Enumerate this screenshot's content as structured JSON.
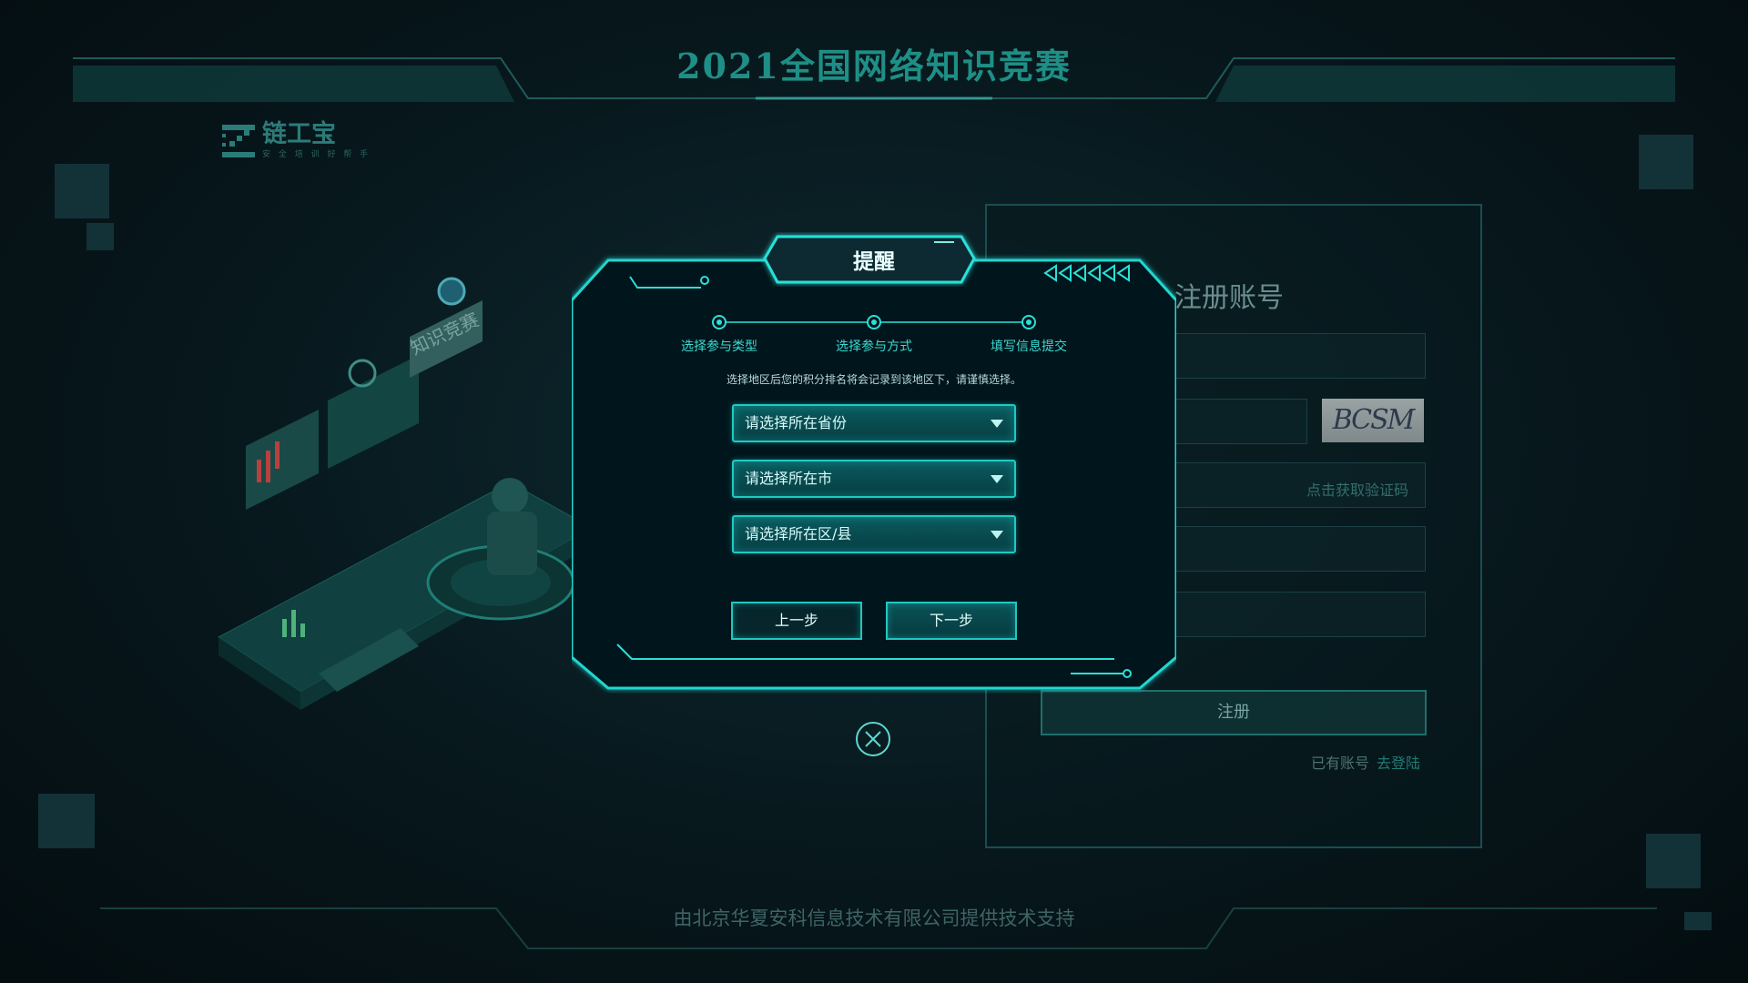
{
  "header": {
    "title": "2021全国网络知识竞赛"
  },
  "logo": {
    "name": "链工宝",
    "subtitle": "安 全 培 训 好 帮 手"
  },
  "register_panel": {
    "title": "注册账号",
    "captcha_text": "BCSM",
    "sms_link": "点击获取验证码",
    "register_button": "注册",
    "has_account": "已有账号",
    "login_link": "去登陆"
  },
  "illustration": {
    "sign_text": "知识竞赛"
  },
  "modal": {
    "title": "提醒",
    "steps": [
      {
        "label": "选择参与类型"
      },
      {
        "label": "选择参与方式"
      },
      {
        "label": "填写信息提交"
      }
    ],
    "notice": "选择地区后您的积分排名将会记录到该地区下，请谨慎选择。",
    "province_placeholder": "请选择所在省份",
    "city_placeholder": "请选择所在市",
    "district_placeholder": "请选择所在区/县",
    "prev_button": "上一步",
    "next_button": "下一步"
  },
  "footer": {
    "text": "由北京华夏安科信息技术有限公司提供技术支持"
  },
  "colors": {
    "accent": "#1fc9c3",
    "title": "#1e8f86",
    "background": "#07171c"
  },
  "icons": [
    "close-icon",
    "caret-down-icon",
    "logo-icon"
  ]
}
